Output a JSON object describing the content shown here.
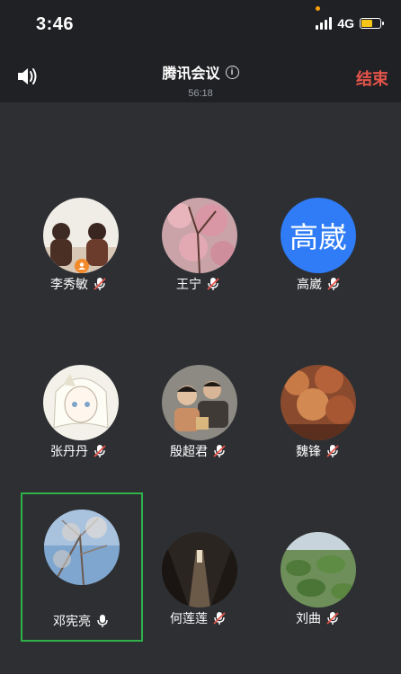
{
  "status_bar": {
    "time": "3:46",
    "network": "4G"
  },
  "header": {
    "title": "腾讯会议",
    "duration": "56:18",
    "end_label": "结束"
  },
  "participants": [
    {
      "name": "李秀敏",
      "mic": "muted",
      "is_host": true
    },
    {
      "name": "王宁",
      "mic": "muted"
    },
    {
      "name": "高崴",
      "mic": "muted",
      "initials": "高崴",
      "avatar_color": "#2f7cf6"
    },
    {
      "name": "张丹丹",
      "mic": "muted"
    },
    {
      "name": "殷超君",
      "mic": "muted"
    },
    {
      "name": "魏锋",
      "mic": "muted"
    },
    {
      "name": "邓宪亮",
      "mic": "on",
      "active_speaker": true
    },
    {
      "name": "何莲莲",
      "mic": "muted"
    },
    {
      "name": "刘曲",
      "mic": "muted"
    }
  ],
  "colors": {
    "end": "#e5544b",
    "active_border": "#2fb24a",
    "battery": "#f5c518",
    "host_badge": "#f28a2b"
  }
}
